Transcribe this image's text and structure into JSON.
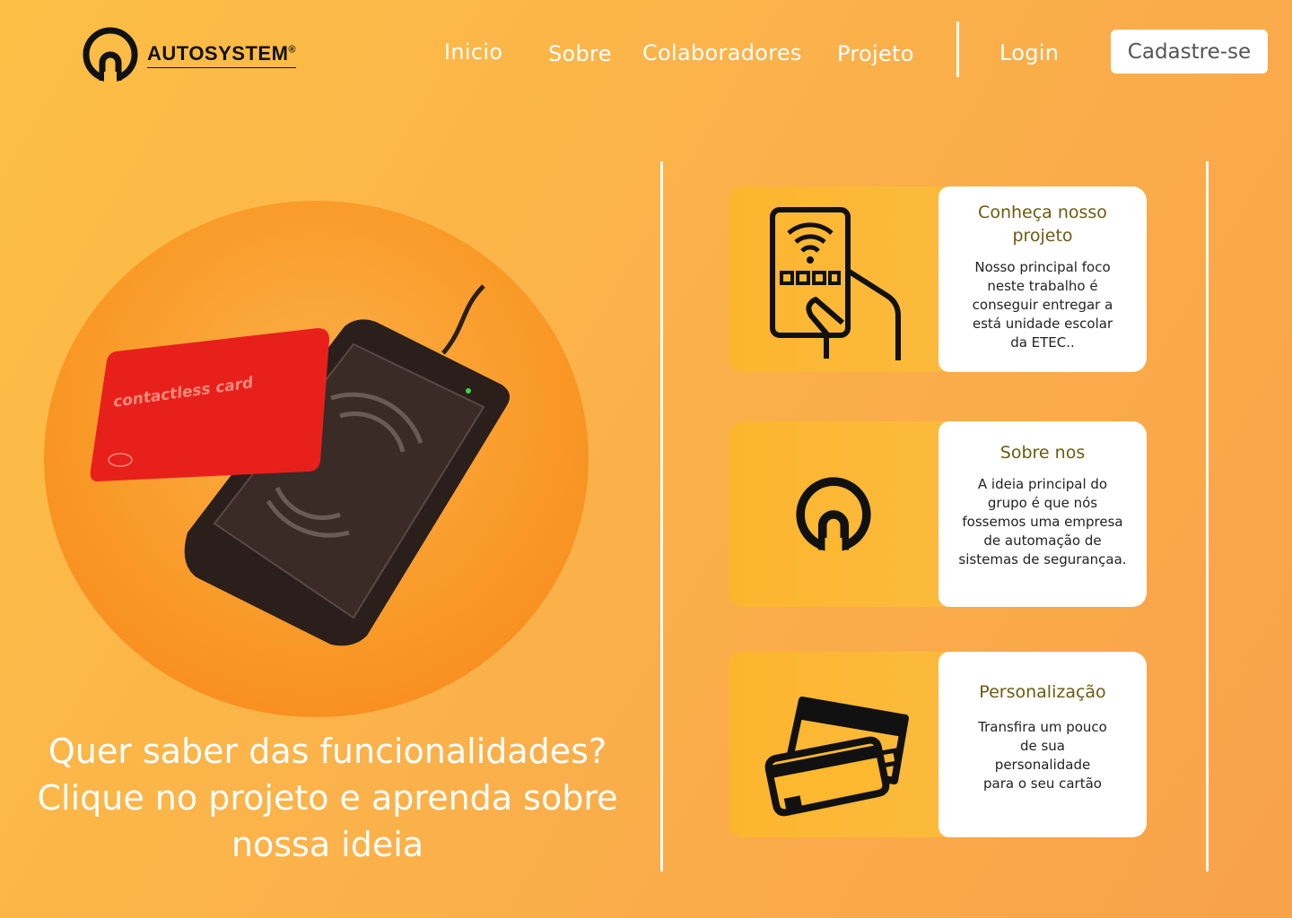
{
  "brand": {
    "name": "AUTOSYSTEM",
    "reg": "®"
  },
  "nav": {
    "inicio": "Inicio",
    "sobre": "Sobre",
    "colaboradores": "Colaboradores",
    "projeto": "Projeto",
    "login": "Login",
    "signup": "Cadastre-se"
  },
  "hero": {
    "card_text": "contactless card",
    "cta": "Quer saber das funcionalidades? Clique no projeto e aprenda sobre nossa ideia"
  },
  "cards": [
    {
      "title": "Conheça nosso projeto",
      "desc": "Nosso principal foco\nneste trabalho é\nconseguir entregar a\nestá unidade escolar\nda ETEC..",
      "icon": "hand-card-icon"
    },
    {
      "title": "Sobre nos",
      "desc": "A ideia principal do\ngrupo é que nós\nfossemos uma empresa\nde automação de\nsistemas de segurançaa.",
      "icon": "brand-logo-icon"
    },
    {
      "title": "Personalização",
      "desc": "Transfira um pouco\nde sua\npersonalidade\npara o seu cartão",
      "icon": "credit-cards-icon"
    }
  ],
  "colors": {
    "accent": "#fbb24a",
    "title_text": "#6b5a10"
  }
}
